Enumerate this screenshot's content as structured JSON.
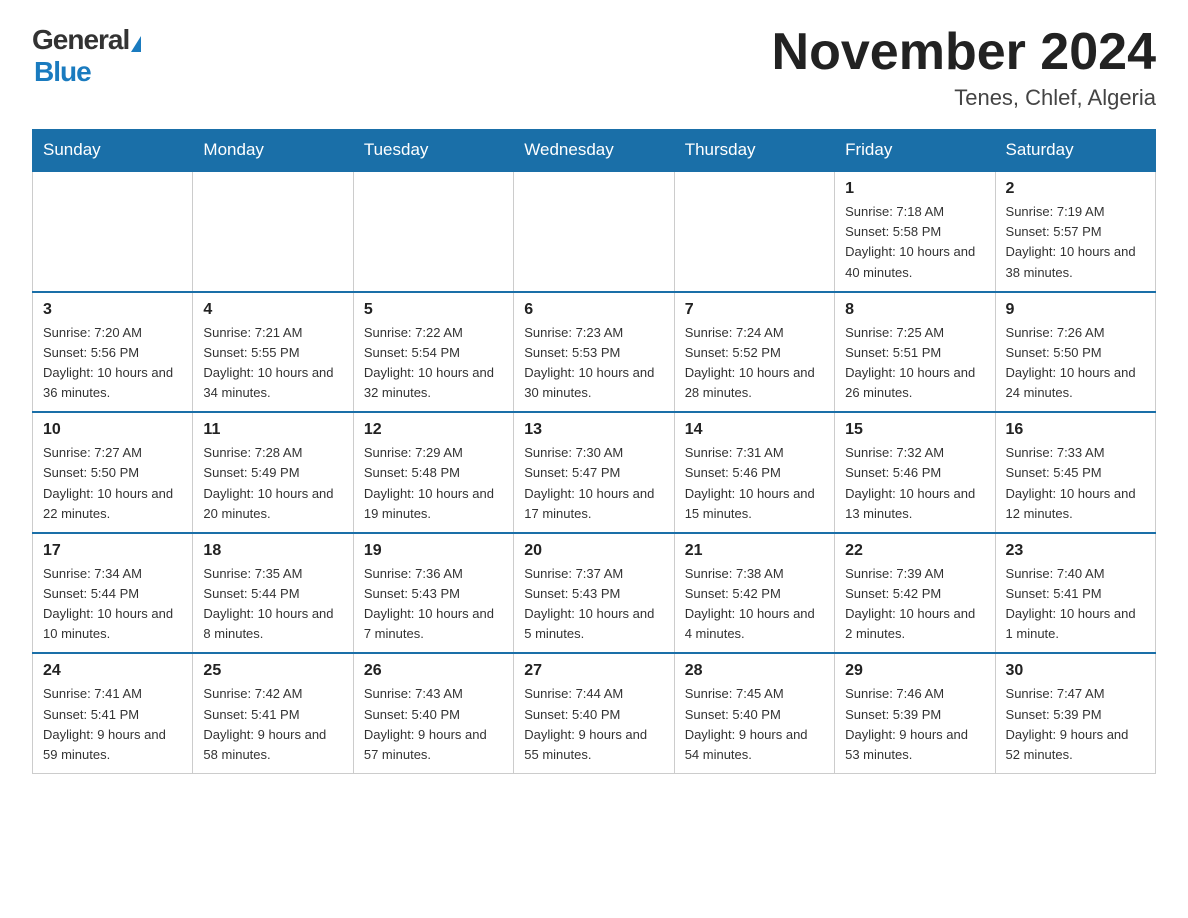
{
  "header": {
    "logo_general": "General",
    "logo_blue": "Blue",
    "month_title": "November 2024",
    "location": "Tenes, Chlef, Algeria"
  },
  "weekdays": [
    "Sunday",
    "Monday",
    "Tuesday",
    "Wednesday",
    "Thursday",
    "Friday",
    "Saturday"
  ],
  "weeks": [
    [
      {
        "day": "",
        "info": ""
      },
      {
        "day": "",
        "info": ""
      },
      {
        "day": "",
        "info": ""
      },
      {
        "day": "",
        "info": ""
      },
      {
        "day": "",
        "info": ""
      },
      {
        "day": "1",
        "info": "Sunrise: 7:18 AM\nSunset: 5:58 PM\nDaylight: 10 hours and 40 minutes."
      },
      {
        "day": "2",
        "info": "Sunrise: 7:19 AM\nSunset: 5:57 PM\nDaylight: 10 hours and 38 minutes."
      }
    ],
    [
      {
        "day": "3",
        "info": "Sunrise: 7:20 AM\nSunset: 5:56 PM\nDaylight: 10 hours and 36 minutes."
      },
      {
        "day": "4",
        "info": "Sunrise: 7:21 AM\nSunset: 5:55 PM\nDaylight: 10 hours and 34 minutes."
      },
      {
        "day": "5",
        "info": "Sunrise: 7:22 AM\nSunset: 5:54 PM\nDaylight: 10 hours and 32 minutes."
      },
      {
        "day": "6",
        "info": "Sunrise: 7:23 AM\nSunset: 5:53 PM\nDaylight: 10 hours and 30 minutes."
      },
      {
        "day": "7",
        "info": "Sunrise: 7:24 AM\nSunset: 5:52 PM\nDaylight: 10 hours and 28 minutes."
      },
      {
        "day": "8",
        "info": "Sunrise: 7:25 AM\nSunset: 5:51 PM\nDaylight: 10 hours and 26 minutes."
      },
      {
        "day": "9",
        "info": "Sunrise: 7:26 AM\nSunset: 5:50 PM\nDaylight: 10 hours and 24 minutes."
      }
    ],
    [
      {
        "day": "10",
        "info": "Sunrise: 7:27 AM\nSunset: 5:50 PM\nDaylight: 10 hours and 22 minutes."
      },
      {
        "day": "11",
        "info": "Sunrise: 7:28 AM\nSunset: 5:49 PM\nDaylight: 10 hours and 20 minutes."
      },
      {
        "day": "12",
        "info": "Sunrise: 7:29 AM\nSunset: 5:48 PM\nDaylight: 10 hours and 19 minutes."
      },
      {
        "day": "13",
        "info": "Sunrise: 7:30 AM\nSunset: 5:47 PM\nDaylight: 10 hours and 17 minutes."
      },
      {
        "day": "14",
        "info": "Sunrise: 7:31 AM\nSunset: 5:46 PM\nDaylight: 10 hours and 15 minutes."
      },
      {
        "day": "15",
        "info": "Sunrise: 7:32 AM\nSunset: 5:46 PM\nDaylight: 10 hours and 13 minutes."
      },
      {
        "day": "16",
        "info": "Sunrise: 7:33 AM\nSunset: 5:45 PM\nDaylight: 10 hours and 12 minutes."
      }
    ],
    [
      {
        "day": "17",
        "info": "Sunrise: 7:34 AM\nSunset: 5:44 PM\nDaylight: 10 hours and 10 minutes."
      },
      {
        "day": "18",
        "info": "Sunrise: 7:35 AM\nSunset: 5:44 PM\nDaylight: 10 hours and 8 minutes."
      },
      {
        "day": "19",
        "info": "Sunrise: 7:36 AM\nSunset: 5:43 PM\nDaylight: 10 hours and 7 minutes."
      },
      {
        "day": "20",
        "info": "Sunrise: 7:37 AM\nSunset: 5:43 PM\nDaylight: 10 hours and 5 minutes."
      },
      {
        "day": "21",
        "info": "Sunrise: 7:38 AM\nSunset: 5:42 PM\nDaylight: 10 hours and 4 minutes."
      },
      {
        "day": "22",
        "info": "Sunrise: 7:39 AM\nSunset: 5:42 PM\nDaylight: 10 hours and 2 minutes."
      },
      {
        "day": "23",
        "info": "Sunrise: 7:40 AM\nSunset: 5:41 PM\nDaylight: 10 hours and 1 minute."
      }
    ],
    [
      {
        "day": "24",
        "info": "Sunrise: 7:41 AM\nSunset: 5:41 PM\nDaylight: 9 hours and 59 minutes."
      },
      {
        "day": "25",
        "info": "Sunrise: 7:42 AM\nSunset: 5:41 PM\nDaylight: 9 hours and 58 minutes."
      },
      {
        "day": "26",
        "info": "Sunrise: 7:43 AM\nSunset: 5:40 PM\nDaylight: 9 hours and 57 minutes."
      },
      {
        "day": "27",
        "info": "Sunrise: 7:44 AM\nSunset: 5:40 PM\nDaylight: 9 hours and 55 minutes."
      },
      {
        "day": "28",
        "info": "Sunrise: 7:45 AM\nSunset: 5:40 PM\nDaylight: 9 hours and 54 minutes."
      },
      {
        "day": "29",
        "info": "Sunrise: 7:46 AM\nSunset: 5:39 PM\nDaylight: 9 hours and 53 minutes."
      },
      {
        "day": "30",
        "info": "Sunrise: 7:47 AM\nSunset: 5:39 PM\nDaylight: 9 hours and 52 minutes."
      }
    ]
  ]
}
